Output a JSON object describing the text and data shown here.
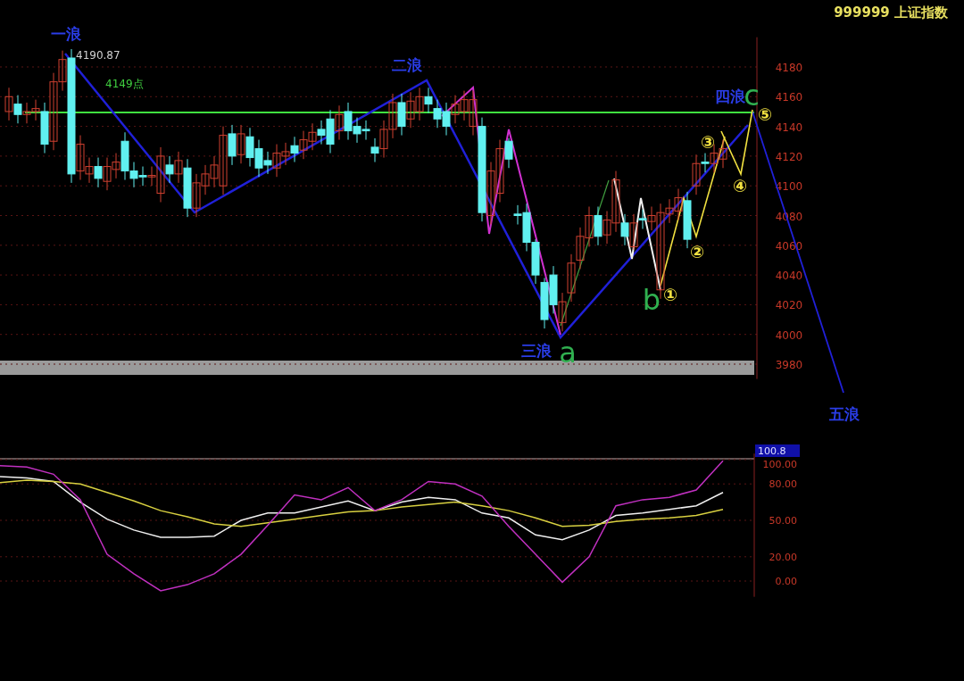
{
  "header": {
    "title": "999999 上证指数"
  },
  "price_chart": {
    "high_label": "4190.87",
    "level_label": "4149点",
    "wave_labels": [
      {
        "kind": "wave",
        "text": "一浪"
      },
      {
        "kind": "wave",
        "text": "二浪"
      },
      {
        "kind": "wave",
        "text": "三浪"
      },
      {
        "kind": "wave",
        "text": "四浪"
      },
      {
        "kind": "wave",
        "text": "五浪"
      },
      {
        "kind": "letter",
        "text": "a"
      },
      {
        "kind": "letter",
        "text": "b"
      },
      {
        "kind": "letter",
        "text": "c"
      },
      {
        "kind": "number",
        "text": "①"
      },
      {
        "kind": "number",
        "text": "②"
      },
      {
        "kind": "number",
        "text": "③"
      },
      {
        "kind": "number",
        "text": "④"
      },
      {
        "kind": "number",
        "text": "⑤"
      }
    ],
    "chart_data": {
      "type": "candlestick",
      "ylim": [
        3970,
        4200
      ],
      "grid": true,
      "yticks": [
        4180,
        4160,
        4140,
        4120,
        4100,
        4080,
        4060,
        4040,
        4020,
        4000,
        3980
      ],
      "categories": [
        null,
        null,
        null,
        null,
        null,
        null,
        null,
        null,
        null,
        null,
        null,
        null,
        null,
        null,
        null,
        null,
        null,
        null,
        null,
        null,
        null,
        null,
        null,
        null,
        null,
        null,
        null,
        null,
        null,
        null,
        null,
        null,
        null,
        null,
        null,
        null,
        null,
        null,
        null,
        null,
        null,
        null,
        null,
        null,
        null,
        null,
        null,
        null,
        null,
        null,
        null,
        null,
        null,
        null,
        null,
        null,
        null,
        null,
        null,
        null,
        null,
        null,
        null,
        null,
        null,
        null,
        null,
        null,
        null,
        null,
        null,
        null,
        null,
        null,
        null,
        null,
        null,
        null,
        null,
        null,
        null
      ],
      "ohlc": [
        [
          4150,
          4166,
          4144,
          4160
        ],
        [
          4155,
          4161,
          4142,
          4148
        ],
        [
          4148,
          4156,
          4142,
          4150
        ],
        [
          4150,
          4158,
          4144,
          4152
        ],
        [
          4150,
          4156,
          4122,
          4128
        ],
        [
          4130,
          4176,
          4124,
          4170
        ],
        [
          4170,
          4191,
          4164,
          4185
        ],
        [
          4186,
          4192,
          4102,
          4108
        ],
        [
          4110,
          4134,
          4104,
          4128
        ],
        [
          4108,
          4119,
          4102,
          4113
        ],
        [
          4113,
          4119,
          4099,
          4105
        ],
        [
          4103,
          4119,
          4097,
          4113
        ],
        [
          4111,
          4122,
          4105,
          4116
        ],
        [
          4130,
          4136,
          4104,
          4110
        ],
        [
          4110,
          4116,
          4099,
          4105
        ],
        [
          4107,
          4113,
          4100,
          4106
        ],
        [
          4106,
          4113,
          4100,
          4107
        ],
        [
          4095,
          4126,
          4089,
          4120
        ],
        [
          4114,
          4120,
          4102,
          4108
        ],
        [
          4108,
          4123,
          4102,
          4117
        ],
        [
          4112,
          4118,
          4079,
          4085
        ],
        [
          4085,
          4108,
          4079,
          4102
        ],
        [
          4100,
          4114,
          4094,
          4108
        ],
        [
          4105,
          4120,
          4099,
          4114
        ],
        [
          4100,
          4140,
          4094,
          4134
        ],
        [
          4135,
          4141,
          4114,
          4120
        ],
        [
          4121,
          4141,
          4115,
          4135
        ],
        [
          4133,
          4139,
          4113,
          4119
        ],
        [
          4125,
          4131,
          4106,
          4112
        ],
        [
          4117,
          4123,
          4108,
          4114
        ],
        [
          4112,
          4128,
          4106,
          4122
        ],
        [
          4120,
          4129,
          4114,
          4123
        ],
        [
          4127,
          4133,
          4116,
          4122
        ],
        [
          4124,
          4137,
          4118,
          4131
        ],
        [
          4130,
          4142,
          4124,
          4136
        ],
        [
          4138,
          4144,
          4128,
          4134
        ],
        [
          4145,
          4151,
          4122,
          4128
        ],
        [
          4137,
          4154,
          4131,
          4148
        ],
        [
          4150,
          4156,
          4131,
          4137
        ],
        [
          4140,
          4146,
          4129,
          4135
        ],
        [
          4138,
          4144,
          4131,
          4137
        ],
        [
          4126,
          4132,
          4116,
          4122
        ],
        [
          4125,
          4144,
          4119,
          4138
        ],
        [
          4138,
          4162,
          4132,
          4156
        ],
        [
          4156,
          4162,
          4134,
          4140
        ],
        [
          4145,
          4163,
          4139,
          4157
        ],
        [
          4150,
          4166,
          4144,
          4160
        ],
        [
          4160,
          4166,
          4149,
          4155
        ],
        [
          4152,
          4158,
          4139,
          4145
        ],
        [
          4150,
          4156,
          4134,
          4140
        ],
        [
          4148,
          4161,
          4142,
          4155
        ],
        [
          4150,
          4164,
          4144,
          4158
        ],
        [
          4140,
          4164,
          4134,
          4158
        ],
        [
          4140,
          4146,
          4076,
          4082
        ],
        [
          4080,
          4116,
          4074,
          4110
        ],
        [
          4095,
          4131,
          4089,
          4125
        ],
        [
          4130,
          4132,
          4112,
          4118
        ],
        [
          4081,
          4087,
          4074,
          4080
        ],
        [
          4082,
          4088,
          4056,
          4062
        ],
        [
          4062,
          4064,
          4034,
          4040
        ],
        [
          4035,
          4038,
          4004,
          4010
        ],
        [
          4040,
          4046,
          4014,
          4020
        ],
        [
          4008,
          4028,
          4002,
          4022
        ],
        [
          4028,
          4054,
          4022,
          4048
        ],
        [
          4050,
          4072,
          4044,
          4066
        ],
        [
          4065,
          4086,
          4059,
          4080
        ],
        [
          4080,
          4086,
          4060,
          4066
        ],
        [
          4067,
          4083,
          4061,
          4077
        ],
        [
          4075,
          4110,
          4069,
          4104
        ],
        [
          4075,
          4081,
          4060,
          4066
        ],
        [
          4059,
          4081,
          4057,
          4075
        ],
        [
          4078,
          4084,
          4071,
          4077
        ],
        [
          4076,
          4086,
          4070,
          4080
        ],
        [
          4030,
          4088,
          4024,
          4082
        ],
        [
          4081,
          4091,
          4075,
          4085
        ],
        [
          4083,
          4098,
          4077,
          4092
        ],
        [
          4090,
          4096,
          4058,
          4064
        ],
        [
          4100,
          4121,
          4094,
          4115
        ],
        [
          4116,
          4122,
          4109,
          4115
        ],
        [
          4115,
          4128,
          4109,
          4122
        ],
        [
          4118,
          4131,
          4112,
          4125
        ]
      ]
    }
  },
  "indicator_chart": {
    "top_value": "100.8",
    "chart_data": {
      "type": "line",
      "ylim": [
        -13,
        105
      ],
      "grid": true,
      "yticks": [
        {
          "value": 0,
          "label": "0.00"
        },
        {
          "value": 20,
          "label": "20.00"
        },
        {
          "value": 50,
          "label": "50.00"
        },
        {
          "value": 80,
          "label": "80.00"
        },
        {
          "value": 100,
          "label": "100.00"
        }
      ],
      "categories": [
        null,
        null,
        null,
        null,
        null,
        null,
        null,
        null,
        null,
        null,
        null,
        null,
        null,
        null,
        null,
        null,
        null,
        null,
        null,
        null,
        null,
        null,
        null,
        null,
        null,
        null,
        null,
        null
      ],
      "series": [
        {
          "color": "#f0f0f0",
          "values": [
            86,
            85,
            82,
            65,
            51,
            42,
            36,
            36,
            37,
            50,
            56,
            56,
            61,
            66,
            58,
            65,
            69,
            67,
            56,
            52,
            38,
            34,
            42,
            54,
            56,
            59,
            62,
            73
          ]
        },
        {
          "color": "#d8d040",
          "values": [
            81,
            83,
            82,
            80,
            73,
            66,
            58,
            53,
            47,
            45,
            48,
            51,
            54,
            57,
            58,
            61,
            63,
            65,
            62,
            58,
            52,
            45,
            46,
            49,
            51,
            52,
            54,
            59
          ]
        },
        {
          "color": "#c030c0",
          "values": [
            95,
            94,
            88,
            67,
            22,
            6,
            -8,
            -3,
            6,
            22,
            46,
            71,
            67,
            77,
            58,
            67,
            82,
            80,
            70,
            45,
            22,
            -1,
            20,
            62,
            67,
            69,
            75,
            99
          ]
        }
      ]
    }
  }
}
